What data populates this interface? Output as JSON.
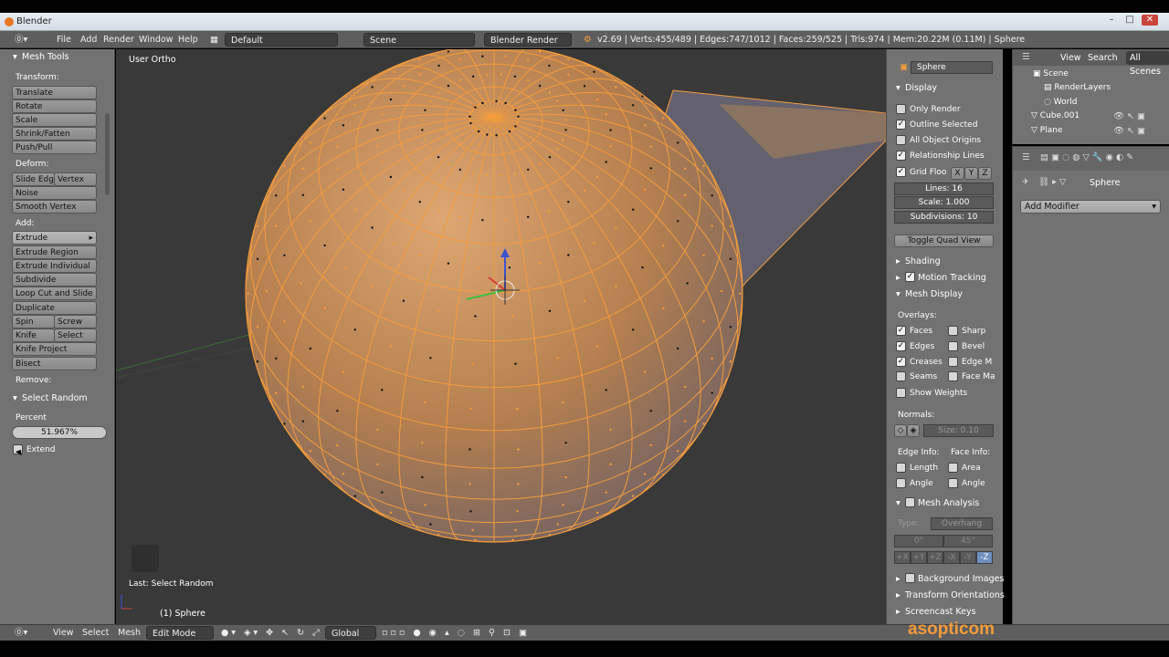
{
  "window": {
    "title": "Blender"
  },
  "header": {
    "menu": [
      "File",
      "Add",
      "Render",
      "Window",
      "Help"
    ],
    "layout": "Default",
    "scene": "Scene",
    "engine": "Blender Render",
    "stats": "v2.69 | Verts:455/489 | Edges:747/1012 | Faces:259/525 | Tris:974 | Mem:20.22M (0.11M) | Sphere"
  },
  "toolshelf": {
    "title": "Mesh Tools",
    "transform_label": "Transform:",
    "transform": [
      "Translate",
      "Rotate",
      "Scale",
      "Shrink/Fatten",
      "Push/Pull"
    ],
    "deform_label": "Deform:",
    "slide_edge": "Slide Edg",
    "vertex": "Vertex",
    "noise": "Noise",
    "smooth_vertex": "Smooth Vertex",
    "add_label": "Add:",
    "extrude": "Extrude",
    "extrude_region": "Extrude Region",
    "extrude_individual": "Extrude Individual",
    "subdivide": "Subdivide",
    "loop_cut": "Loop Cut and Slide",
    "duplicate": "Duplicate",
    "spin": "Spin",
    "screw": "Screw",
    "knife": "Knife",
    "select": "Select",
    "knife_project": "Knife Project",
    "bisect": "Bisect",
    "remove_label": "Remove:",
    "operator_title": "Select Random",
    "percent_label": "Percent",
    "percent_value": "51.967%",
    "extend_label": "Extend"
  },
  "viewport": {
    "view_label": "User Ortho",
    "last_op": "Last: Select Random",
    "object_label": "(1) Sphere"
  },
  "npanel": {
    "object_name": "Sphere",
    "display": "Display",
    "only_render": "Only Render",
    "outline_selected": "Outline Selected",
    "all_object_origins": "All Object Origins",
    "relationship_lines": "Relationship Lines",
    "grid_floor": "Grid Floo",
    "axis_x": "X",
    "axis_y": "Y",
    "axis_z": "Z",
    "lines": "Lines: 16",
    "scale": "Scale: 1.000",
    "subdivisions": "Subdivisions: 10",
    "toggle_quad": "Toggle Quad View",
    "shading": "Shading",
    "motion_tracking": "Motion Tracking",
    "mesh_display": "Mesh Display",
    "overlays": "Overlays:",
    "faces": "Faces",
    "sharp": "Sharp",
    "edges": "Edges",
    "bevel": "Bevel",
    "creases": "Creases",
    "edge_marks": "Edge M",
    "seams": "Seams",
    "face_marks": "Face Ma",
    "show_weights": "Show Weights",
    "normals": "Normals:",
    "normal_size": "Size: 0.10",
    "edge_info": "Edge Info:",
    "face_info": "Face Info:",
    "length": "Length",
    "area": "Area",
    "angle_e": "Angle",
    "angle_f": "Angle",
    "mesh_analysis": "Mesh Analysis",
    "type_label": "Type:",
    "type_value": "Overhang",
    "deg_min": "0°",
    "deg_max": "45°",
    "axes": [
      "+X",
      "+Y",
      "+Z",
      "-X",
      "-Y",
      "-Z"
    ],
    "background_images": "Background Images",
    "transform_orientations": "Transform Orientations",
    "screencast_keys": "Screencast Keys"
  },
  "outliner": {
    "view": "View",
    "search": "Search",
    "all_scenes": "All Scenes",
    "items": [
      "Scene",
      "RenderLayers",
      "World",
      "Cube.001",
      "Plane"
    ]
  },
  "properties": {
    "object": "Sphere",
    "add_modifier": "Add Modifier"
  },
  "footer": {
    "menus": [
      "View",
      "Select",
      "Mesh"
    ],
    "mode": "Edit Mode",
    "orientation": "Global"
  },
  "watermark": "asopticom",
  "colors": {
    "accent_orange": "#f39c3c",
    "viewport_bg": "#393939",
    "panel_bg": "#727272"
  }
}
